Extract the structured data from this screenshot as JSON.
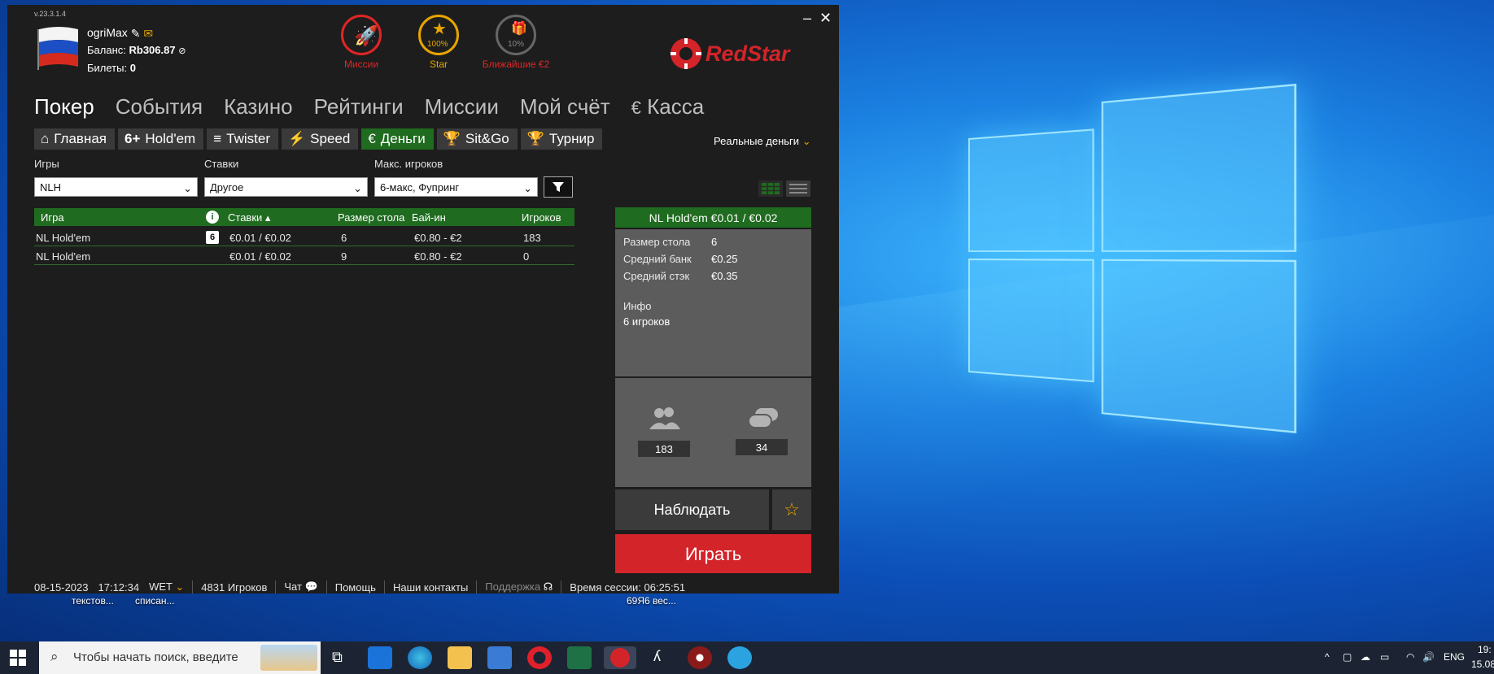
{
  "app": {
    "version": "v.23.3.1.4",
    "user": {
      "name": "ogriMax",
      "balance_label": "Баланс:",
      "balance_value": "Rb306.87",
      "tickets_label": "Билеты:",
      "tickets_value": "0"
    },
    "missions": [
      {
        "label": "Миссии",
        "color": "#e02525",
        "percent": ""
      },
      {
        "label": "Star",
        "color": "#e8a500",
        "percent": "100%"
      },
      {
        "label": "Ближайшие €2",
        "color": "#e02525",
        "percent": "10%"
      }
    ],
    "brand": "RedStar",
    "main_nav": [
      "Покер",
      "События",
      "Казино",
      "Рейтинги",
      "Миссии",
      "Мой счёт",
      "Касса"
    ],
    "sub_tabs": [
      "Главная",
      "Hold'em",
      "Twister",
      "Speed",
      "Деньги",
      "Sit&Go",
      "Турнир"
    ],
    "sub_tab_icons": [
      "home-icon",
      "holdem-6plus-icon",
      "twister-icon",
      "lightning-icon",
      "euro-coin-icon",
      "trophy-icon",
      "trophy-cup-icon"
    ],
    "real_money": "Реальные деньги",
    "filters": {
      "games_label": "Игры",
      "games_value": "NLH",
      "stakes_label": "Ставки",
      "stakes_value": "Другое",
      "maxplayers_label": "Макс. игроков",
      "maxplayers_value": "6-макс, Фупринг"
    },
    "table": {
      "headers": {
        "game": "Игра",
        "stakes": "Ставки ▴",
        "size": "Размер стола",
        "buyin": "Бай-ин",
        "players": "Игроков"
      },
      "rows": [
        {
          "game": "NL Hold'em",
          "badge": "6",
          "stakes": "€0.01 / €0.02",
          "size": "6",
          "buyin": "€0.80 - €2",
          "players": "183"
        },
        {
          "game": "NL Hold'em",
          "badge": "",
          "stakes": "€0.01 / €0.02",
          "size": "9",
          "buyin": "€0.80 - €2",
          "players": "0"
        }
      ]
    },
    "detail": {
      "title": "NL Hold'em €0.01 / €0.02",
      "size_label": "Размер стола",
      "size_value": "6",
      "pot_label": "Средний банк",
      "pot_value": "€0.25",
      "stack_label": "Средний стэк",
      "stack_value": "€0.35",
      "info_label": "Инфо",
      "info_value": "6 игроков",
      "players_count": "183",
      "tables_count": "34",
      "observe": "Наблюдать",
      "play": "Играть"
    },
    "footer": {
      "date": "08-15-2023",
      "time": "17:12:34",
      "tz": "WET",
      "players": "4831 Игроков",
      "chat": "Чат",
      "help": "Помощь",
      "contacts": "Наши контакты",
      "support": "Поддержка",
      "session": "Время сессии: 06:25:51"
    }
  },
  "desktop": {
    "labels": [
      "текстов...",
      "списан...",
      "69Я6 вес..."
    ]
  },
  "taskbar": {
    "search_placeholder": "Чтобы начать поиск, введите",
    "lang": "ENG",
    "clock_time": "19:",
    "clock_date": "15.08."
  }
}
